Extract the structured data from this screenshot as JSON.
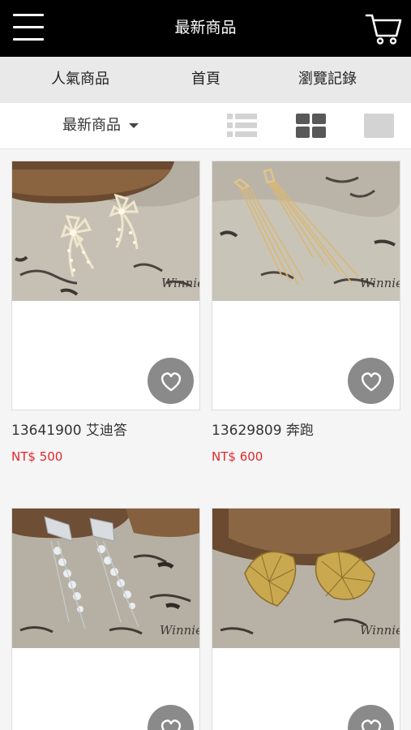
{
  "header": {
    "title": "最新商品",
    "menu_icon": "hamburger-icon",
    "cart_icon": "cart-icon"
  },
  "nav": {
    "items": [
      {
        "label": "人氣商品"
      },
      {
        "label": "首頁"
      },
      {
        "label": "瀏覽記錄"
      }
    ]
  },
  "filter": {
    "sort_label": "最新商品",
    "view_icons": [
      "list-view-icon",
      "grid-view-icon",
      "single-view-icon"
    ]
  },
  "products": [
    {
      "name": "13641900 艾迪答",
      "price": "NT$ 500",
      "watermark": "Winnie"
    },
    {
      "name": "13629809 奔跑",
      "price": "NT$ 600",
      "watermark": "Winnie"
    },
    {
      "name": "",
      "price": "",
      "watermark": "Winnie"
    },
    {
      "name": "",
      "price": "",
      "watermark": "Winnie"
    }
  ],
  "colors": {
    "header_bg": "#000000",
    "nav_bg": "#e9e9e9",
    "price": "#e0292b",
    "fav_button": "#8a8a8a"
  }
}
